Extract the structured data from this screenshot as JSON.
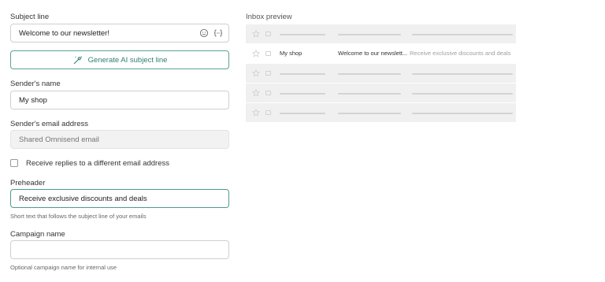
{
  "form": {
    "subject": {
      "label": "Subject line",
      "value": "Welcome to our newsletter!"
    },
    "ai_button": {
      "label": "Generate AI subject line"
    },
    "sender_name": {
      "label": "Sender's name",
      "value": "My shop"
    },
    "sender_email": {
      "label": "Sender's email address",
      "placeholder": "Shared Omnisend email"
    },
    "replies_checkbox": {
      "label": "Receive replies to a different email address",
      "checked": false
    },
    "preheader": {
      "label": "Preheader",
      "value": "Receive exclusive discounts and deals",
      "hint": "Short text that follows the subject line of your emails"
    },
    "campaign_name": {
      "label": "Campaign name",
      "value": "",
      "hint": "Optional campaign name for internal use"
    }
  },
  "inbox": {
    "title": "Inbox preview",
    "message": {
      "sender": "My shop",
      "subject": "Welcome to our newslett...",
      "preview": "Receive exclusive discounts and deals"
    }
  },
  "colors": {
    "accent": "#2e7f72",
    "skeleton": "#f0f0f0"
  }
}
